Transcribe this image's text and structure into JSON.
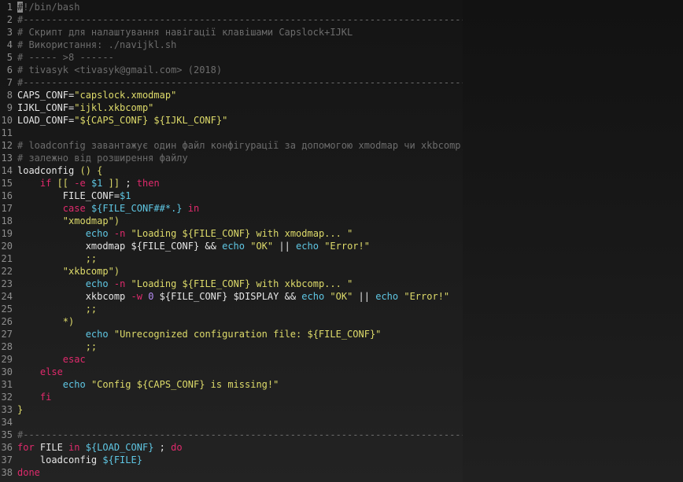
{
  "editor": {
    "lines": [
      {
        "n": "1",
        "tokens": [
          {
            "t": "#",
            "c": "cursor"
          },
          {
            "t": "!/bin/bash",
            "c": "c-comment"
          }
        ]
      },
      {
        "n": "2",
        "tokens": [
          {
            "t": "#---------------------------------------------------------------------------------",
            "c": "c-comment"
          }
        ]
      },
      {
        "n": "3",
        "tokens": [
          {
            "t": "# Скрипт для налаштування навігації клавішами Capslock+IJKL",
            "c": "c-comment"
          }
        ]
      },
      {
        "n": "4",
        "tokens": [
          {
            "t": "# Використання: ./navijkl.sh",
            "c": "c-comment"
          }
        ]
      },
      {
        "n": "5",
        "tokens": [
          {
            "t": "# ----- >8 ------",
            "c": "c-comment"
          }
        ]
      },
      {
        "n": "6",
        "tokens": [
          {
            "t": "# tivasyk <tivasyk@gmail.com> (2018)",
            "c": "c-comment"
          }
        ]
      },
      {
        "n": "7",
        "tokens": [
          {
            "t": "#---------------------------------------------------------------------------------",
            "c": "c-comment"
          }
        ]
      },
      {
        "n": "8",
        "tokens": [
          {
            "t": "CAPS_CONF=",
            "c": "c-default"
          },
          {
            "t": "\"capslock.xmodmap\"",
            "c": "c-str"
          }
        ]
      },
      {
        "n": "9",
        "tokens": [
          {
            "t": "IJKL_CONF=",
            "c": "c-default"
          },
          {
            "t": "\"ijkl.xkbcomp\"",
            "c": "c-str"
          }
        ]
      },
      {
        "n": "10",
        "tokens": [
          {
            "t": "LOAD_CONF=",
            "c": "c-default"
          },
          {
            "t": "\"${CAPS_CONF} ${IJKL_CONF}\"",
            "c": "c-str"
          }
        ]
      },
      {
        "n": "11",
        "tokens": []
      },
      {
        "n": "12",
        "tokens": [
          {
            "t": "# loadconfig завантажує один файл конфігурації за допомогою xmodmap чи xkbcomp,",
            "c": "c-comment"
          }
        ]
      },
      {
        "n": "13",
        "tokens": [
          {
            "t": "# залежно від розширення файлу",
            "c": "c-comment"
          }
        ]
      },
      {
        "n": "14",
        "tokens": [
          {
            "t": "loadconfig ",
            "c": "c-default"
          },
          {
            "t": "() {",
            "c": "c-str"
          }
        ]
      },
      {
        "n": "15",
        "tokens": [
          {
            "t": "    ",
            "c": "c-default"
          },
          {
            "t": "if",
            "c": "c-kw"
          },
          {
            "t": " [[ ",
            "c": "c-str"
          },
          {
            "t": "-e",
            "c": "c-kw"
          },
          {
            "t": " ",
            "c": "c-default"
          },
          {
            "t": "$1",
            "c": "c-var"
          },
          {
            "t": " ]] ",
            "c": "c-str"
          },
          {
            "t": "; ",
            "c": "c-default"
          },
          {
            "t": "then",
            "c": "c-kw"
          }
        ]
      },
      {
        "n": "16",
        "tokens": [
          {
            "t": "        FILE_CONF=",
            "c": "c-default"
          },
          {
            "t": "$1",
            "c": "c-var"
          }
        ]
      },
      {
        "n": "17",
        "tokens": [
          {
            "t": "        ",
            "c": "c-default"
          },
          {
            "t": "case",
            "c": "c-kw"
          },
          {
            "t": " ",
            "c": "c-default"
          },
          {
            "t": "${FILE_CONF##*.}",
            "c": "c-var"
          },
          {
            "t": " ",
            "c": "c-default"
          },
          {
            "t": "in",
            "c": "c-kw"
          }
        ]
      },
      {
        "n": "18",
        "tokens": [
          {
            "t": "        ",
            "c": "c-default"
          },
          {
            "t": "\"xmodmap\")",
            "c": "c-str"
          }
        ]
      },
      {
        "n": "19",
        "tokens": [
          {
            "t": "            ",
            "c": "c-default"
          },
          {
            "t": "echo",
            "c": "c-var"
          },
          {
            "t": " ",
            "c": "c-default"
          },
          {
            "t": "-n",
            "c": "c-kw"
          },
          {
            "t": " ",
            "c": "c-default"
          },
          {
            "t": "\"Loading ${FILE_CONF} with xmodmap... \"",
            "c": "c-str"
          }
        ]
      },
      {
        "n": "20",
        "tokens": [
          {
            "t": "            xmodmap ${FILE_CONF} && ",
            "c": "c-default"
          },
          {
            "t": "echo",
            "c": "c-var"
          },
          {
            "t": " ",
            "c": "c-default"
          },
          {
            "t": "\"OK\"",
            "c": "c-str"
          },
          {
            "t": " || ",
            "c": "c-default"
          },
          {
            "t": "echo",
            "c": "c-var"
          },
          {
            "t": " ",
            "c": "c-default"
          },
          {
            "t": "\"Error!\"",
            "c": "c-str"
          }
        ]
      },
      {
        "n": "21",
        "tokens": [
          {
            "t": "            ",
            "c": "c-default"
          },
          {
            "t": ";;",
            "c": "c-str"
          }
        ]
      },
      {
        "n": "22",
        "tokens": [
          {
            "t": "        ",
            "c": "c-default"
          },
          {
            "t": "\"xkbcomp\")",
            "c": "c-str"
          }
        ]
      },
      {
        "n": "23",
        "tokens": [
          {
            "t": "            ",
            "c": "c-default"
          },
          {
            "t": "echo",
            "c": "c-var"
          },
          {
            "t": " ",
            "c": "c-default"
          },
          {
            "t": "-n",
            "c": "c-kw"
          },
          {
            "t": " ",
            "c": "c-default"
          },
          {
            "t": "\"Loading ${FILE_CONF} with xkbcomp... \"",
            "c": "c-str"
          }
        ]
      },
      {
        "n": "24",
        "tokens": [
          {
            "t": "            xkbcomp ",
            "c": "c-default"
          },
          {
            "t": "-w",
            "c": "c-kw"
          },
          {
            "t": " ",
            "c": "c-default"
          },
          {
            "t": "0",
            "c": "c-num"
          },
          {
            "t": " ${FILE_CONF} $DISPLAY && ",
            "c": "c-default"
          },
          {
            "t": "echo",
            "c": "c-var"
          },
          {
            "t": " ",
            "c": "c-default"
          },
          {
            "t": "\"OK\"",
            "c": "c-str"
          },
          {
            "t": " || ",
            "c": "c-default"
          },
          {
            "t": "echo",
            "c": "c-var"
          },
          {
            "t": " ",
            "c": "c-default"
          },
          {
            "t": "\"Error!\"",
            "c": "c-str"
          }
        ]
      },
      {
        "n": "25",
        "tokens": [
          {
            "t": "            ",
            "c": "c-default"
          },
          {
            "t": ";;",
            "c": "c-str"
          }
        ]
      },
      {
        "n": "26",
        "tokens": [
          {
            "t": "        ",
            "c": "c-default"
          },
          {
            "t": "*)",
            "c": "c-str"
          }
        ]
      },
      {
        "n": "27",
        "tokens": [
          {
            "t": "            ",
            "c": "c-default"
          },
          {
            "t": "echo",
            "c": "c-var"
          },
          {
            "t": " ",
            "c": "c-default"
          },
          {
            "t": "\"Unrecognized configuration file: ${FILE_CONF}\"",
            "c": "c-str"
          }
        ]
      },
      {
        "n": "28",
        "tokens": [
          {
            "t": "            ",
            "c": "c-default"
          },
          {
            "t": ";;",
            "c": "c-str"
          }
        ]
      },
      {
        "n": "29",
        "tokens": [
          {
            "t": "        ",
            "c": "c-default"
          },
          {
            "t": "esac",
            "c": "c-kw"
          }
        ]
      },
      {
        "n": "30",
        "tokens": [
          {
            "t": "    ",
            "c": "c-default"
          },
          {
            "t": "else",
            "c": "c-kw"
          }
        ]
      },
      {
        "n": "31",
        "tokens": [
          {
            "t": "        ",
            "c": "c-default"
          },
          {
            "t": "echo",
            "c": "c-var"
          },
          {
            "t": " ",
            "c": "c-default"
          },
          {
            "t": "\"Config ${CAPS_CONF} is missing!\"",
            "c": "c-str"
          }
        ]
      },
      {
        "n": "32",
        "tokens": [
          {
            "t": "    ",
            "c": "c-default"
          },
          {
            "t": "fi",
            "c": "c-kw"
          }
        ]
      },
      {
        "n": "33",
        "tokens": [
          {
            "t": "}",
            "c": "c-str"
          }
        ]
      },
      {
        "n": "34",
        "tokens": []
      },
      {
        "n": "35",
        "tokens": [
          {
            "t": "#---------------------------------------------------------------------------------",
            "c": "c-comment"
          }
        ]
      },
      {
        "n": "36",
        "tokens": [
          {
            "t": "for",
            "c": "c-kw"
          },
          {
            "t": " FILE ",
            "c": "c-default"
          },
          {
            "t": "in",
            "c": "c-kw"
          },
          {
            "t": " ",
            "c": "c-default"
          },
          {
            "t": "${LOAD_CONF}",
            "c": "c-var"
          },
          {
            "t": " ; ",
            "c": "c-default"
          },
          {
            "t": "do",
            "c": "c-kw"
          }
        ]
      },
      {
        "n": "37",
        "tokens": [
          {
            "t": "    loadconfig ",
            "c": "c-default"
          },
          {
            "t": "${FILE}",
            "c": "c-var"
          }
        ]
      },
      {
        "n": "38",
        "tokens": [
          {
            "t": "done",
            "c": "c-kw"
          }
        ]
      }
    ]
  }
}
